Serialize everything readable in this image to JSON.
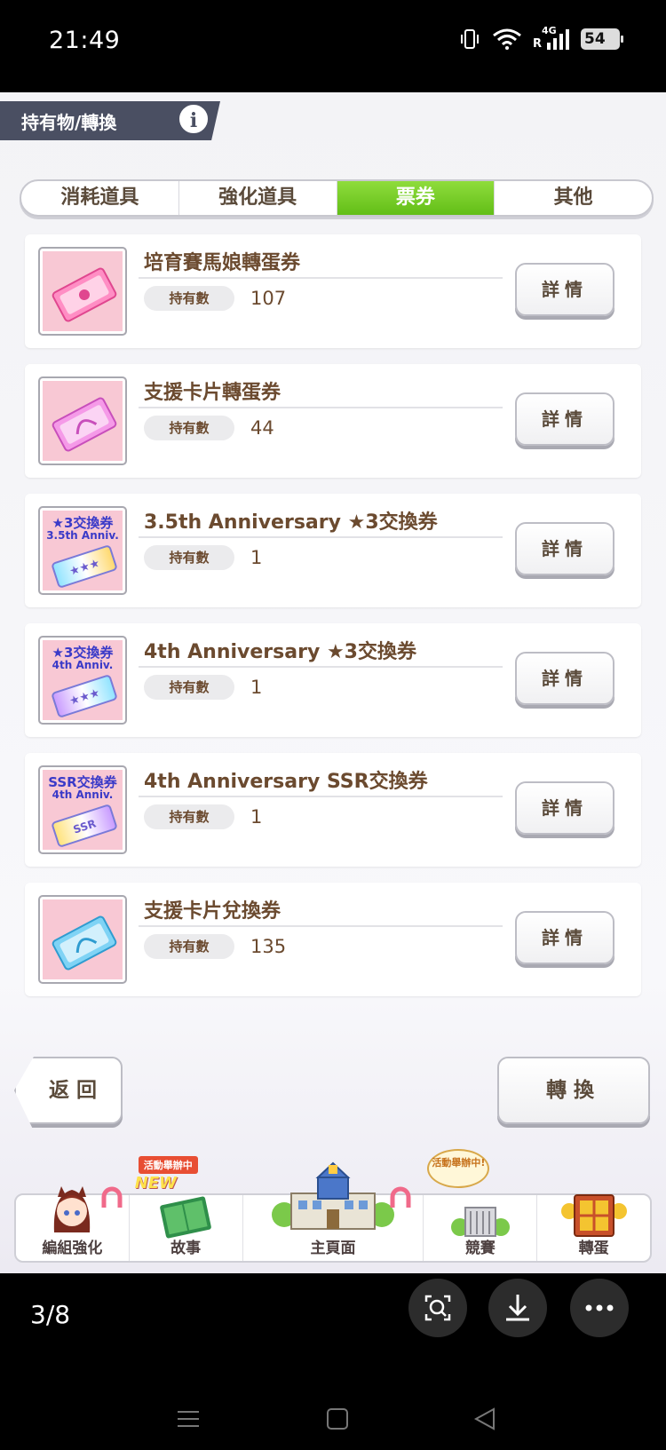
{
  "status_bar": {
    "time": "21:49",
    "network": "4G",
    "roaming": "R",
    "battery": "54"
  },
  "header": {
    "title": "持有物/轉換",
    "info_label": "i"
  },
  "tabs": [
    {
      "label": "消耗道具",
      "active": false
    },
    {
      "label": "強化道具",
      "active": false
    },
    {
      "label": "票券",
      "active": true
    },
    {
      "label": "其他",
      "active": false
    }
  ],
  "items": [
    {
      "name": "培育賽馬娘轉蛋券",
      "own_label": "持有數",
      "count": "107",
      "detail_label": "詳情",
      "icon": "pink-ticket-icon",
      "color": "#ff6fae"
    },
    {
      "name": "支援卡片轉蛋券",
      "own_label": "持有數",
      "count": "44",
      "detail_label": "詳情",
      "icon": "magenta-ticket-icon",
      "color": "#f07de6"
    },
    {
      "name": "3.5th Anniversary ★3交換券",
      "own_label": "持有數",
      "count": "1",
      "detail_label": "詳情",
      "icon": "rainbow-ticket-icon",
      "thumb_line1": "★3交換券",
      "thumb_line2": "3.5th Anniv."
    },
    {
      "name": "4th Anniversary ★3交換券",
      "own_label": "持有數",
      "count": "1",
      "detail_label": "詳情",
      "icon": "rainbow-ticket-icon",
      "thumb_line1": "★3交換券",
      "thumb_line2": "4th Anniv."
    },
    {
      "name": "4th Anniversary SSR交換券",
      "own_label": "持有數",
      "count": "1",
      "detail_label": "詳情",
      "icon": "rainbow-ticket-icon",
      "thumb_line1": "SSR交換券",
      "thumb_line2": "4th Anniv."
    },
    {
      "name": "支援卡片兌換券",
      "own_label": "持有數",
      "count": "135",
      "detail_label": "詳情",
      "icon": "blue-ticket-icon",
      "color": "#5fc6f0"
    }
  ],
  "actions": {
    "back_label": "返回",
    "convert_label": "轉換"
  },
  "bottom_nav": {
    "team": "編組強化",
    "story": "故事",
    "story_badge": "活動舉辦中",
    "story_new": "NEW",
    "home": "主頁面",
    "race": "競賽",
    "race_bubble": "活動舉辦中!",
    "gacha": "轉蛋"
  },
  "viewer": {
    "page": "3/8"
  }
}
